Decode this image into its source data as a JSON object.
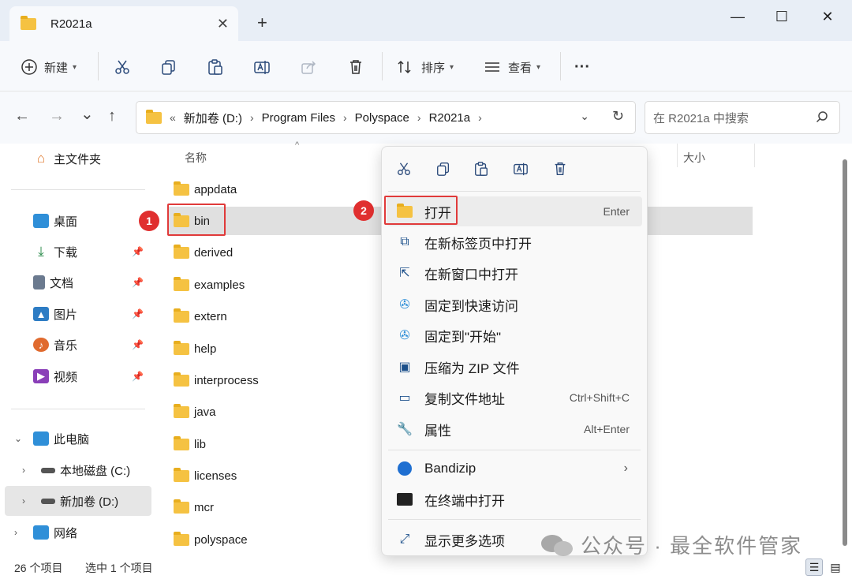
{
  "window": {
    "tab_title": "R2021a",
    "tab_close": "✕",
    "new_tab": "+",
    "minimize": "—",
    "maximize": "☐",
    "close": "✕"
  },
  "toolbar": {
    "new_label": "新建",
    "sort_label": "排序",
    "view_label": "查看",
    "more_label": "···",
    "icons": [
      "cut-icon",
      "copy-icon",
      "paste-icon",
      "rename-icon",
      "share-icon",
      "delete-icon"
    ]
  },
  "nav": {
    "back": "←",
    "forward": "→",
    "recent": "⌄",
    "up": "↑",
    "breadcrumb_prefix": "«",
    "breadcrumbs": [
      "新加卷 (D:)",
      "Program Files",
      "Polyspace",
      "R2021a"
    ],
    "search_placeholder": "在 R2021a 中搜索"
  },
  "sidebar": {
    "home": "主文件夹",
    "quick": [
      {
        "label": "桌面",
        "icon": "desktop-icon",
        "color": "#2f8fd8"
      },
      {
        "label": "下载",
        "icon": "download-icon",
        "color": "#2a8a4a"
      },
      {
        "label": "文档",
        "icon": "document-icon",
        "color": "#6b7a8f"
      },
      {
        "label": "图片",
        "icon": "pictures-icon",
        "color": "#2d7cc4"
      },
      {
        "label": "音乐",
        "icon": "music-icon",
        "color": "#e06a2e"
      },
      {
        "label": "视频",
        "icon": "video-icon",
        "color": "#8a3fb8"
      }
    ],
    "this_pc": "此电脑",
    "drive_c": "本地磁盘 (C:)",
    "drive_d": "新加卷 (D:)",
    "network": "网络"
  },
  "columns": {
    "name": "名称",
    "size": "大小"
  },
  "files": [
    "appdata",
    "bin",
    "derived",
    "examples",
    "extern",
    "help",
    "interprocess",
    "java",
    "lib",
    "licenses",
    "mcr",
    "polyspace"
  ],
  "selected_file": "bin",
  "status": {
    "count": "26 个项目",
    "selection": "选中 1 个项目"
  },
  "context_menu": {
    "top_icons": [
      "cut-icon",
      "copy-icon",
      "paste-icon",
      "rename-icon",
      "delete-icon"
    ],
    "items": [
      {
        "label": "打开",
        "shortcut": "Enter",
        "icon": "folder-open-icon"
      },
      {
        "label": "在新标签页中打开",
        "shortcut": "",
        "icon": "new-tab-icon"
      },
      {
        "label": "在新窗口中打开",
        "shortcut": "",
        "icon": "new-window-icon"
      },
      {
        "label": "固定到快速访问",
        "shortcut": "",
        "icon": "pin-icon"
      },
      {
        "label": "固定到\"开始\"",
        "shortcut": "",
        "icon": "pin-start-icon"
      },
      {
        "label": "压缩为 ZIP 文件",
        "shortcut": "",
        "icon": "zip-icon"
      },
      {
        "label": "复制文件地址",
        "shortcut": "Ctrl+Shift+C",
        "icon": "copy-path-icon"
      },
      {
        "label": "属性",
        "shortcut": "Alt+Enter",
        "icon": "wrench-icon"
      }
    ],
    "bandizip": "Bandizip",
    "terminal": "在终端中打开",
    "more_options": "显示更多选项"
  },
  "annotations": {
    "badge_1": "1",
    "badge_2": "2",
    "highlight_color": "#e03a3a"
  },
  "watermark": "公众号 · 最全软件管家"
}
